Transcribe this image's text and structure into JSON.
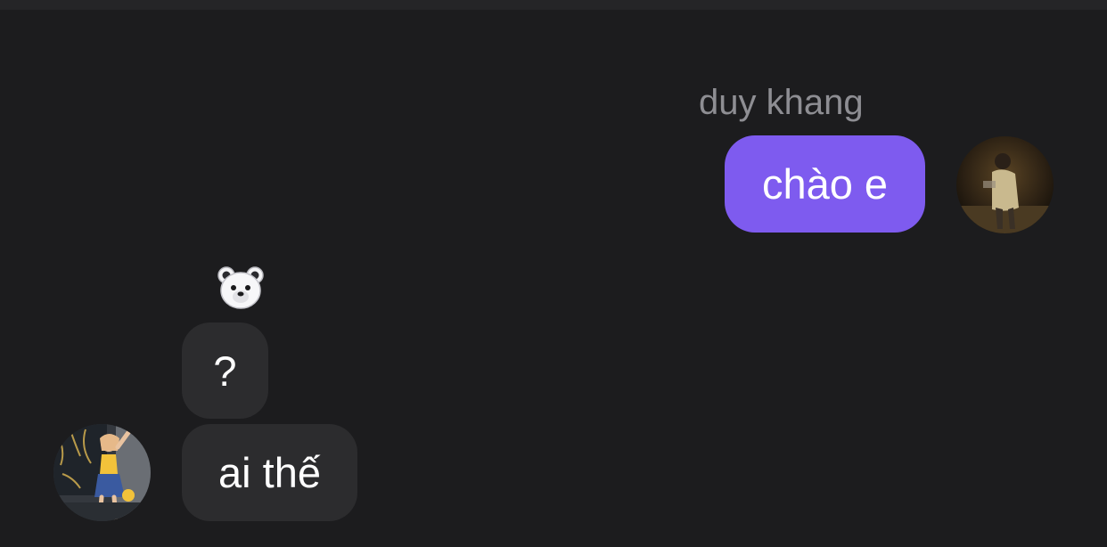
{
  "chat": {
    "outgoing": {
      "sender_name": "duy khang",
      "message": "chào e",
      "bubble_color": "#7e5bef",
      "avatar_icon": "user-avatar-photo"
    },
    "incoming": {
      "sticker_icon": "polar-bear-emoji",
      "messages": [
        "?",
        "ai thế"
      ],
      "bubble_color": "#2c2c2e",
      "avatar_icon": "user-avatar-photo"
    }
  },
  "theme": {
    "background": "#1c1c1e",
    "name_color": "#8e8e93",
    "text_color": "#ffffff"
  }
}
